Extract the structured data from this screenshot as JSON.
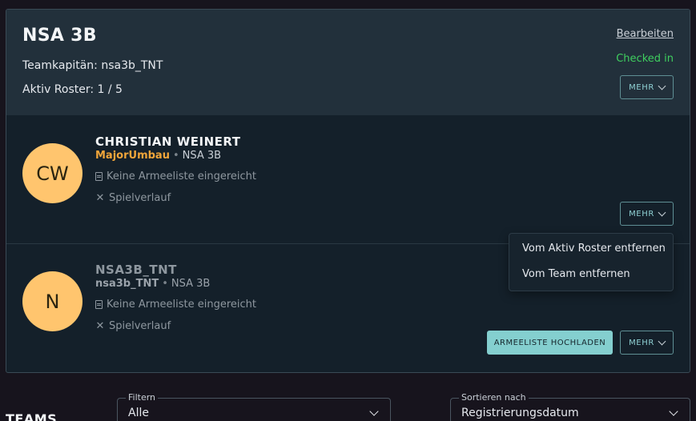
{
  "team": {
    "name": "NSA 3B",
    "captain": "Teamkapitän: nsa3b_TNT",
    "roster": "Aktiv Roster: 1 / 5",
    "edit_label": "Bearbeiten",
    "status": "Checked in",
    "more_label": "MEHR"
  },
  "members": [
    {
      "initials": "CW",
      "name": "CHRISTIAN WEINERT",
      "nick": "MajorUmbau",
      "team": "NSA 3B",
      "armylist": "Keine Armeeliste eingereicht",
      "history": "Spielverlauf",
      "more_label": "MEHR"
    },
    {
      "initials": "N",
      "name": "NSA3B_TNT",
      "nick": "nsa3b_TNT",
      "team": "NSA 3B",
      "armylist": "Keine Armeeliste eingereicht",
      "history": "Spielverlauf",
      "upload_label": "ARMEELISTE HOCHLADEN",
      "more_label": "MEHR"
    }
  ],
  "dropdown": {
    "items": [
      "Vom Aktiv Roster entfernen",
      "Vom Team entfernen"
    ]
  },
  "teams_section": {
    "title": "TEAMS",
    "filter_label": "Filtern",
    "filter_value": "Alle",
    "sort_label": "Sortieren nach",
    "sort_value": "Registrierungsdatum"
  },
  "colors": {
    "accent": "#84cfcf",
    "checked_in": "#3fcf5f",
    "avatar": "#ffc56e",
    "nick_highlight": "#f0a53a"
  }
}
